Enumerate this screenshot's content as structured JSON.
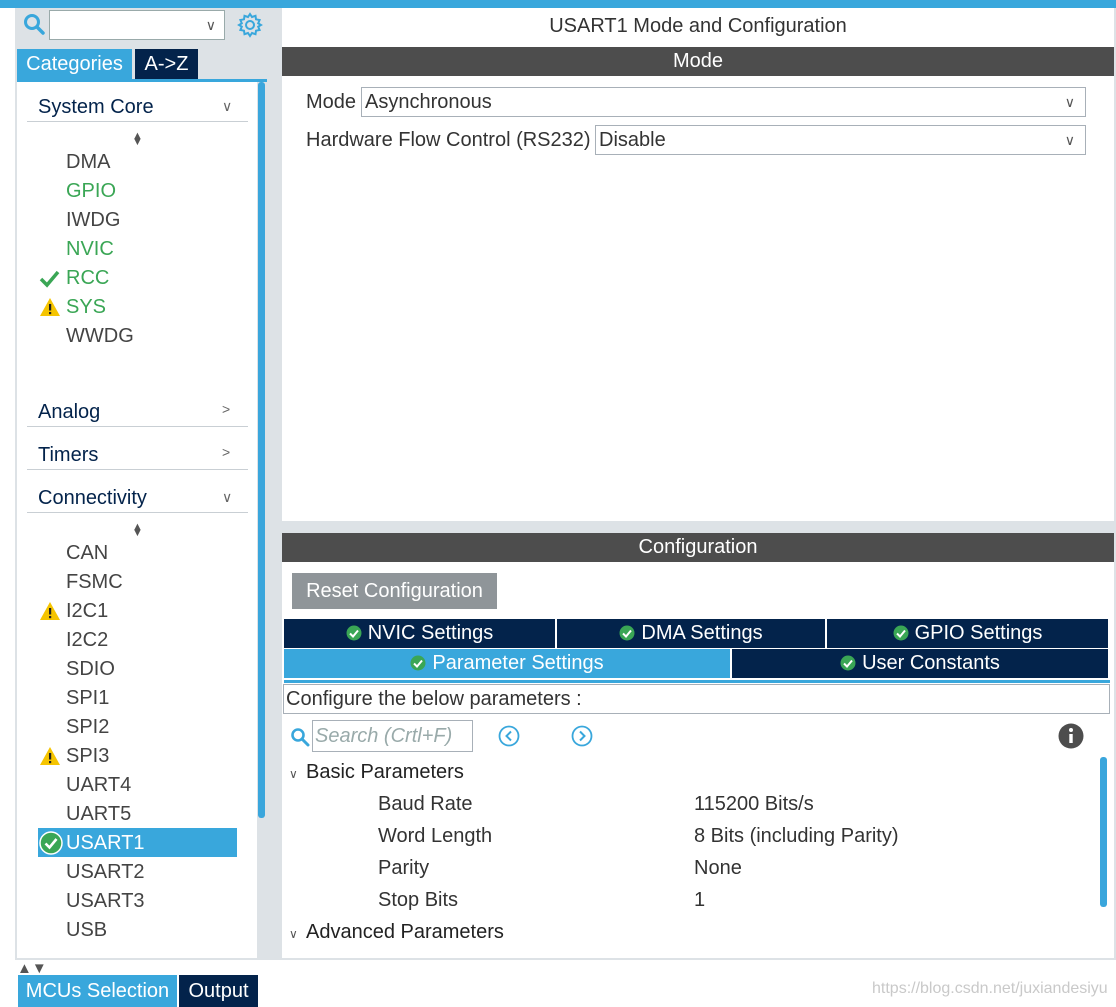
{
  "left": {
    "search_value": "",
    "tabs": {
      "categories": "Categories",
      "az": "A->Z"
    },
    "system_core": {
      "label": "System Core",
      "items": [
        "DMA",
        "GPIO",
        "IWDG",
        "NVIC",
        "RCC",
        "SYS",
        "WWDG"
      ]
    },
    "analog": {
      "label": "Analog"
    },
    "timers": {
      "label": "Timers"
    },
    "connectivity": {
      "label": "Connectivity",
      "items": [
        "CAN",
        "FSMC",
        "I2C1",
        "I2C2",
        "SDIO",
        "SPI1",
        "SPI2",
        "SPI3",
        "UART4",
        "UART5",
        "USART1",
        "USART2",
        "USART3",
        "USB"
      ]
    }
  },
  "bottom": {
    "mcu_tab": "MCUs Selection",
    "output_tab": "Output",
    "watermark": "https://blog.csdn.net/juxiandesiyu"
  },
  "main": {
    "title": "USART1 Mode and Configuration",
    "mode_header": "Mode",
    "mode_label": "Mode",
    "mode_value": "Asynchronous",
    "flow_label": "Hardware Flow Control (RS232)",
    "flow_value": "Disable",
    "config_header": "Configuration",
    "reset_button": "Reset Configuration",
    "tabs": {
      "nvic": "NVIC Settings",
      "dma": "DMA Settings",
      "gpio": "GPIO Settings",
      "param": "Parameter Settings",
      "user": "User Constants"
    },
    "description": "Configure the below parameters :",
    "search_placeholder": "Search (Crtl+F)",
    "basic_group": "Basic Parameters",
    "params": [
      {
        "name": "Baud Rate",
        "value": "115200 Bits/s"
      },
      {
        "name": "Word Length",
        "value": "8 Bits (including Parity)"
      },
      {
        "name": "Parity",
        "value": "None"
      },
      {
        "name": "Stop Bits",
        "value": "1"
      }
    ],
    "advanced_group": "Advanced Parameters"
  },
  "colors": {
    "accent": "#39a7dc",
    "navy": "#03234b",
    "ok_green": "#3aa655",
    "warn_yellow": "#f5c400"
  }
}
